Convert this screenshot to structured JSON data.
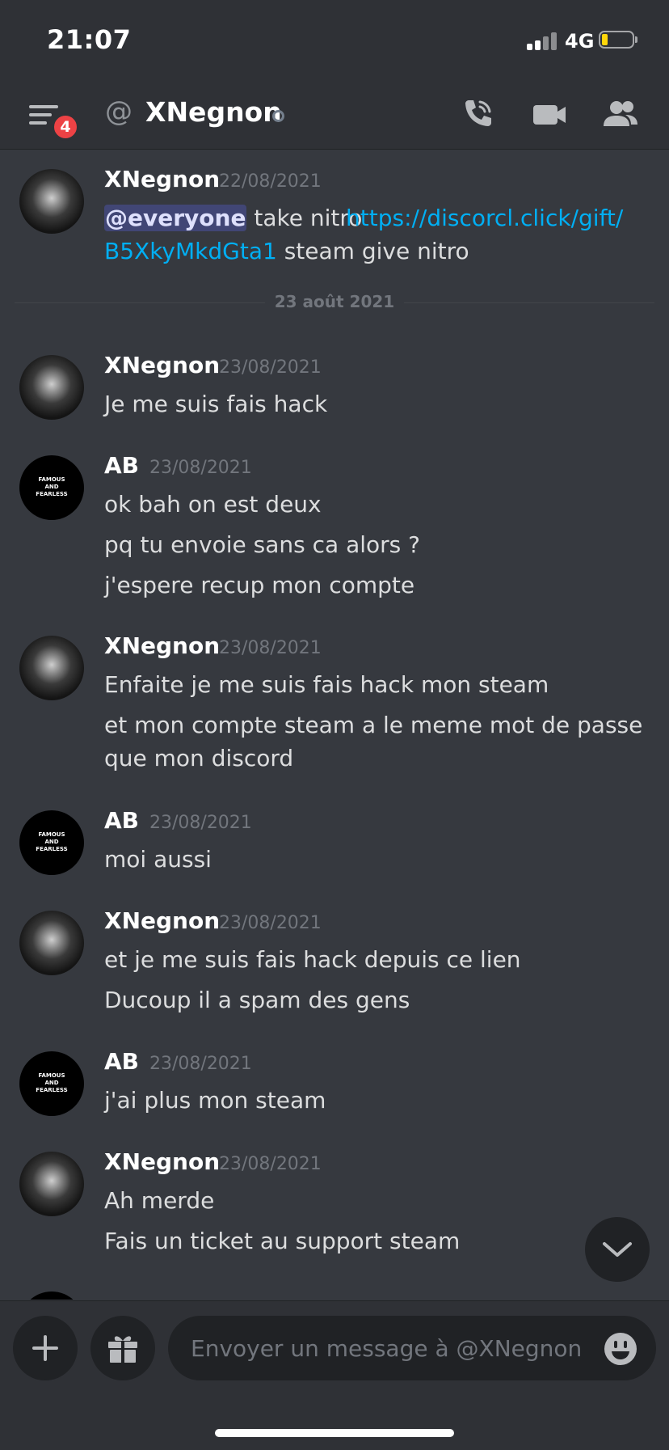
{
  "status_bar": {
    "time": "21:07",
    "network": "4G",
    "battery_color": "#ffd60a"
  },
  "header": {
    "badge_count": "4",
    "at_symbol": "@",
    "channel_title": "XNegnon",
    "icons": [
      "menu-icon",
      "call-icon",
      "video-icon",
      "members-icon"
    ]
  },
  "messages": [
    {
      "author": "XNegnon",
      "timestamp": "22/08/2021",
      "mention": "@everyone",
      "text_after_mention": " take nitro ",
      "link_part1": "https://discorcl.click/gift/",
      "link_part2": "B5XkyMkdGta1",
      "text_after_link": " steam give nitro"
    },
    {
      "date_divider": "23 août 2021"
    },
    {
      "author": "XNegnon",
      "timestamp": "23/08/2021",
      "lines": [
        "Je me suis fais hack"
      ]
    },
    {
      "author": "AB",
      "timestamp": "23/08/2021",
      "lines": [
        "ok bah on est deux",
        "pq tu envoie sans ca alors ?",
        "j'espere recup mon compte"
      ]
    },
    {
      "author": "XNegnon",
      "timestamp": "23/08/2021",
      "lines": [
        "Enfaite je me suis fais hack mon steam",
        "et mon compte steam a le meme mot de passe que mon discord"
      ]
    },
    {
      "author": "AB",
      "timestamp": "23/08/2021",
      "lines": [
        "moi aussi"
      ]
    },
    {
      "author": "XNegnon",
      "timestamp": "23/08/2021",
      "lines": [
        "et je me suis fais hack depuis ce lien",
        "Ducoup il  a spam des gens"
      ]
    },
    {
      "author": "AB",
      "timestamp": "23/08/2021",
      "lines": [
        "j'ai plus mon steam"
      ]
    },
    {
      "author": "XNegnon",
      "timestamp": "23/08/2021",
      "lines": [
        "Ah merde",
        "Fais un ticket au support steam"
      ]
    }
  ],
  "ab_avatar": {
    "line1": "FAMOUS",
    "line2": "AND",
    "line3": "FEARLESS"
  },
  "composer": {
    "placeholder": "Envoyer un message à @XNegnon",
    "icons": [
      "plus-icon",
      "gift-icon",
      "emoji-icon"
    ]
  },
  "colors": {
    "background": "#36393f",
    "header": "#2f3136",
    "link": "#00aff4",
    "mention_bg": "#414675",
    "badge": "#ed4245"
  }
}
